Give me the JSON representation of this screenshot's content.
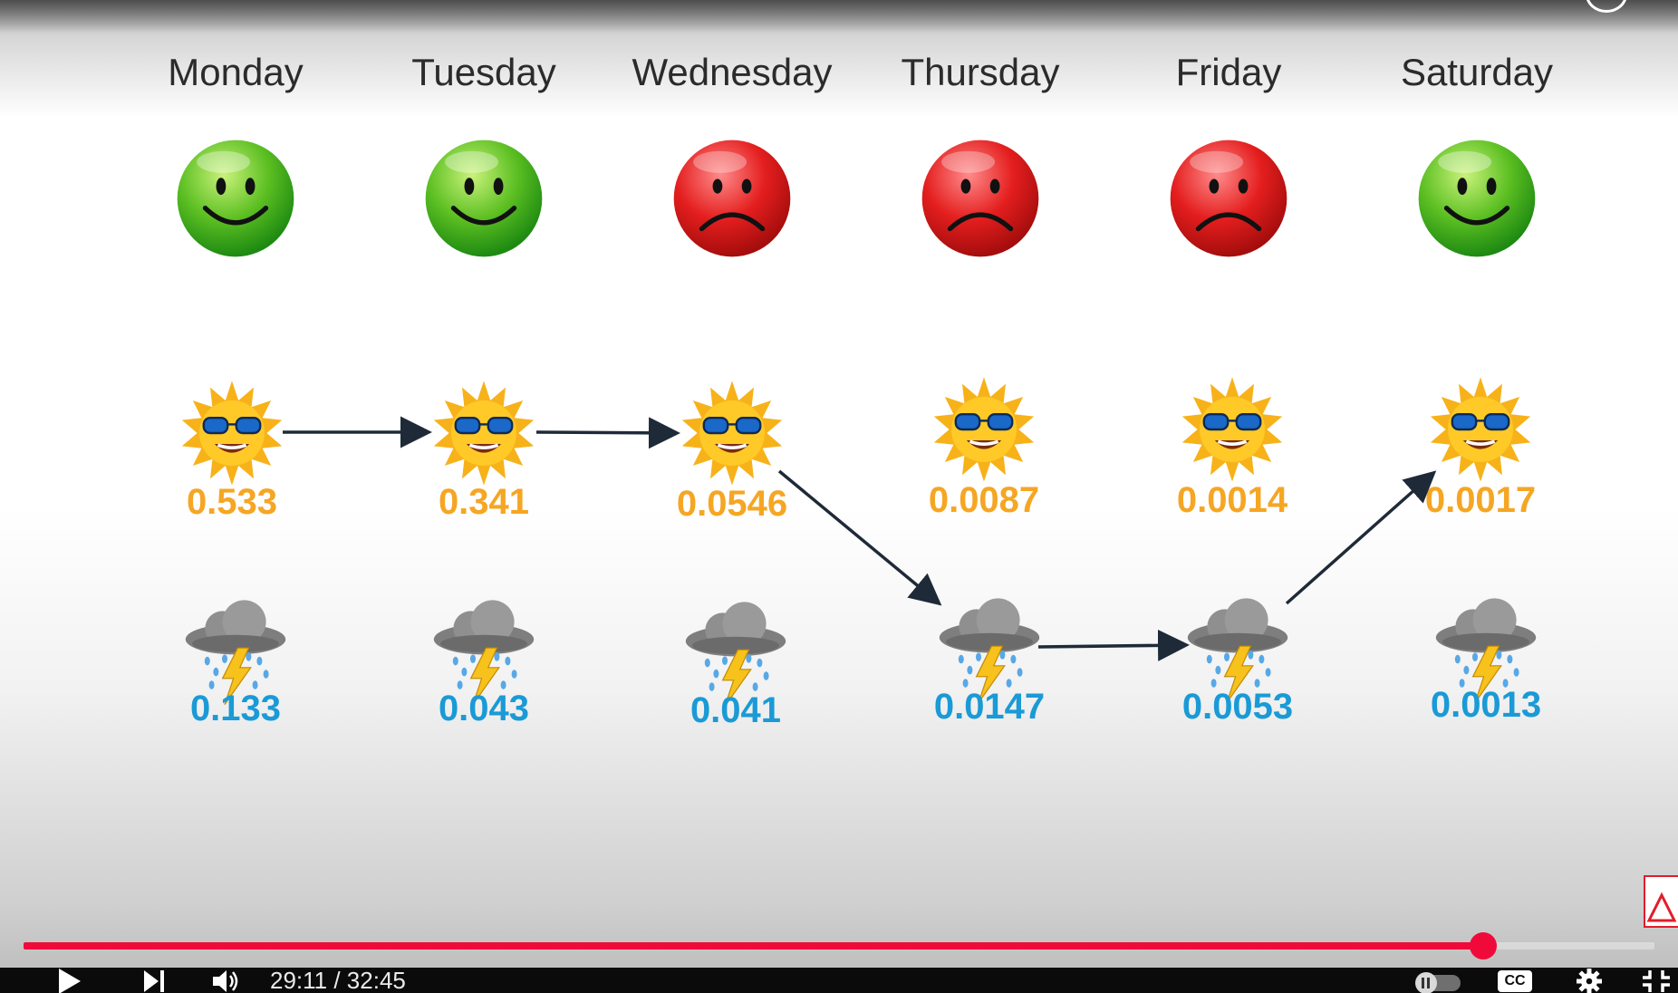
{
  "video": {
    "days": [
      "Monday",
      "Tuesday",
      "Wednesday",
      "Thursday",
      "Friday",
      "Saturday"
    ],
    "moods": [
      "happy",
      "happy",
      "sad",
      "sad",
      "sad",
      "happy"
    ],
    "sunny_probabilities": [
      "0.533",
      "0.341",
      "0.0546",
      "0.0087",
      "0.0014",
      "0.0017"
    ],
    "rainy_probabilities": [
      "0.133",
      "0.043",
      "0.041",
      "0.0147",
      "0.0053",
      "0.0013"
    ],
    "colors": {
      "happy_face": "#3fae1c",
      "sad_face": "#e01b1b",
      "sunny_text": "#f5a623",
      "rainy_text": "#1a9ad6"
    }
  },
  "player": {
    "progress_percent": 89.5,
    "time_display": "29:11 / 32:45",
    "icons": {
      "play": "play-icon",
      "next": "next-icon",
      "volume": "volume-icon",
      "autoplay": "autoplay-toggle-icon",
      "captions": "captions-icon",
      "settings": "gear-icon",
      "fullscreen": "exit-fullscreen-icon"
    },
    "captions_label": "CC",
    "accent": "#f00a3a"
  }
}
